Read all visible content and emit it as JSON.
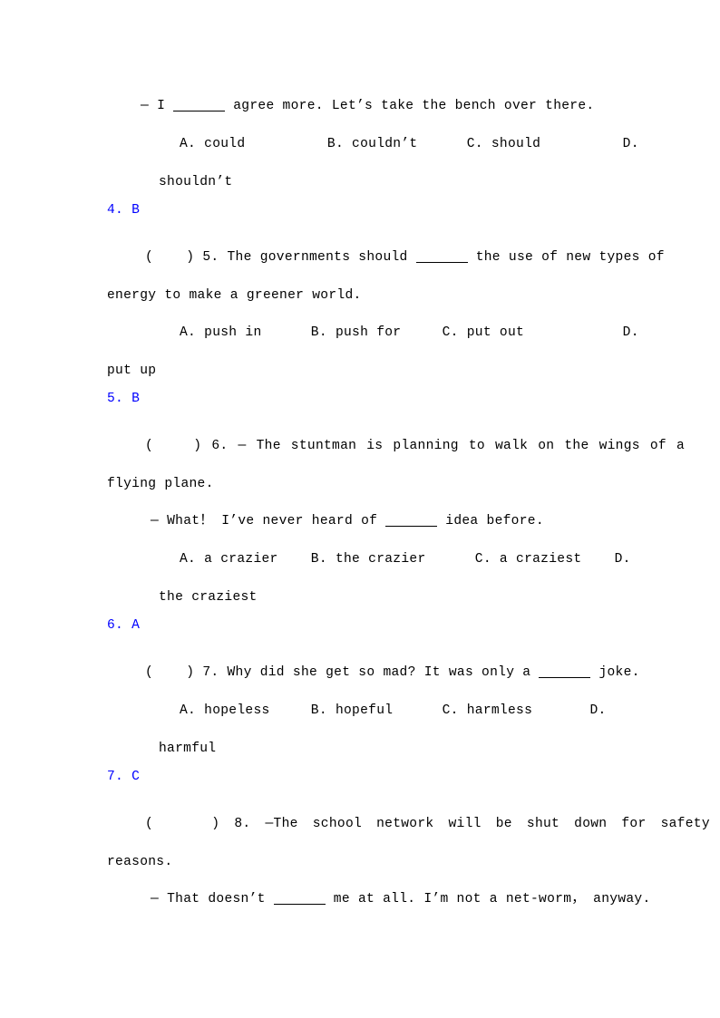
{
  "document": {
    "type": "english-grammar-worksheet-with-answer-key",
    "page_background": "#ffffff",
    "text_color": "#000000",
    "answer_color": "#0000ff",
    "blank_glyph": "________"
  },
  "questions": [
    {
      "number": "4",
      "stem_lines": [
        "— I ",
        " agree more. Let’s take the bench over there."
      ],
      "options_line": "A. could          B. couldn’t      C. should          D.",
      "options_wrap": "shouldn’t",
      "answer": "4. B"
    },
    {
      "number": "5",
      "marker": "(    ) 5. ",
      "stem_a": "The governments should ",
      "stem_b": " the use of new types of",
      "stem_line2": "energy to make a greener world.",
      "options_line": "A. push in      B. push for     C. put out            D.",
      "options_wrap": "put up",
      "answer": "5. B"
    },
    {
      "number": "6",
      "marker": "(    ) 6. ",
      "stem_line1": "— The stuntman is planning to walk on the wings of a",
      "stem_line2": "flying plane.",
      "reply_a": "— What！ I’ve never heard of ",
      "reply_b": " idea before.",
      "reply_punct": "？",
      "options_line": "A. a crazier    B. the crazier      C. a craziest    D.",
      "options_wrap": "the craziest",
      "answer": "6. A"
    },
    {
      "number": "7",
      "marker": "(    ) 7. ",
      "stem_a": "Why did she get so mad? It was only a ",
      "stem_b": " joke.",
      "options_line": "A. hopeless     B. hopeful      C. harmless       D.",
      "options_wrap": "harmful",
      "answer": "7. C"
    },
    {
      "number": "8",
      "marker": "(    ) 8. ",
      "stem_line1": "—The school network will be shut down for safety",
      "stem_line2": "reasons.",
      "reply_a": "— That doesn’t ",
      "reply_b": " me at all. I’m not a net-worm， anyway."
    }
  ]
}
